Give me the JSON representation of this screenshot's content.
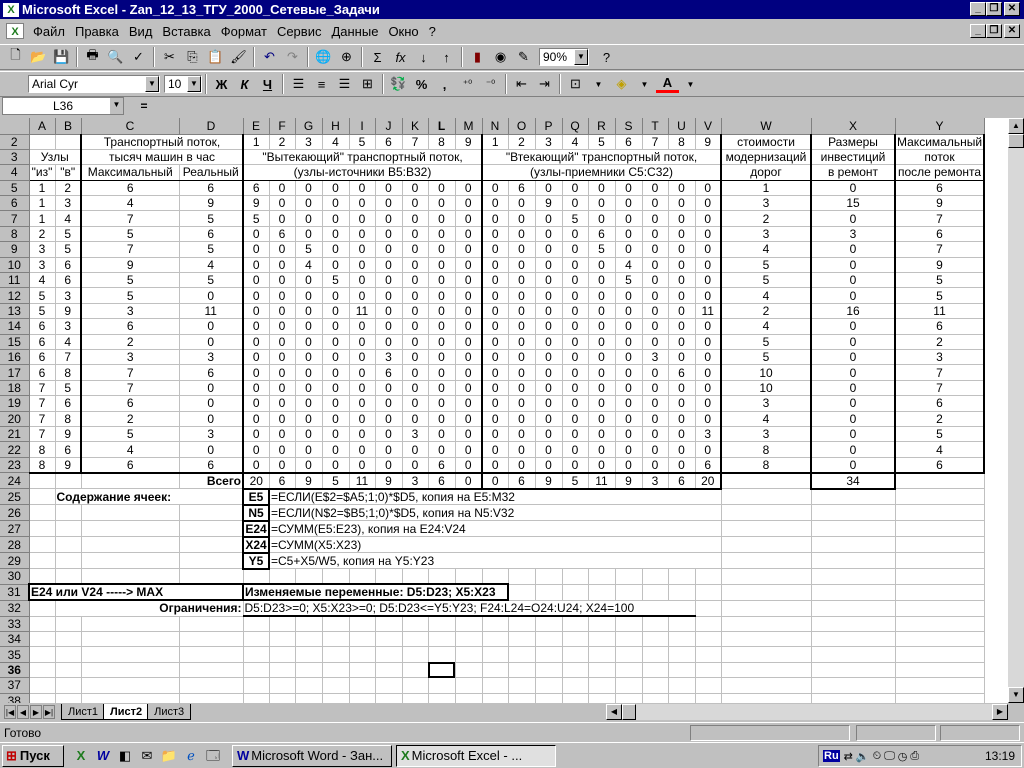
{
  "window": {
    "title": "Microsoft Excel - Zan_12_13_ТГУ_2000_Сетевые_Задачи",
    "icon": "excel-icon"
  },
  "menu": [
    "Файл",
    "Правка",
    "Вид",
    "Вставка",
    "Формат",
    "Сервис",
    "Данные",
    "Окно",
    "?"
  ],
  "toolbar": {
    "zoom": "90%",
    "font_name": "Arial Cyr",
    "font_size": "10",
    "bold_label": "Ж",
    "italic_label": "К",
    "underline_label": "Ч",
    "percent_label": "%",
    "thousands_label": ",",
    "sigma_label": "Σ",
    "fx_label": "fx",
    "help_label": "?"
  },
  "formula_bar": {
    "name_box": "L36",
    "equals": "=",
    "formula": ""
  },
  "sheet": {
    "columns": [
      "A",
      "B",
      "C",
      "D",
      "E",
      "F",
      "G",
      "H",
      "I",
      "J",
      "K",
      "L",
      "M",
      "N",
      "O",
      "P",
      "Q",
      "R",
      "S",
      "T",
      "U",
      "V",
      "W",
      "X",
      "Y"
    ],
    "active_column": "L",
    "active_row": "36",
    "row_headers": [
      "2",
      "3",
      "4",
      "5",
      "6",
      "7",
      "8",
      "9",
      "10",
      "11",
      "12",
      "13",
      "14",
      "15",
      "16",
      "17",
      "18",
      "19",
      "20",
      "21",
      "22",
      "23",
      "24",
      "25",
      "26",
      "27",
      "28",
      "29",
      "30",
      "31",
      "32",
      "33",
      "34",
      "35",
      "36",
      "37",
      "38",
      "39"
    ],
    "header_row2": {
      "C": "Транспортный поток,",
      "out_nums": [
        "1",
        "2",
        "3",
        "4",
        "5",
        "6",
        "7",
        "8",
        "9"
      ],
      "in_nums": [
        "1",
        "2",
        "3",
        "4",
        "5",
        "6",
        "7",
        "8",
        "9"
      ],
      "W": "стоимости",
      "X": "Размеры",
      "Y": "Максимальный"
    },
    "header_row3": {
      "AB": "Узлы",
      "C": "тысяч машин в час",
      "out": "\"Вытекающий\" транспортный поток,",
      "in": "\"Втекающий\" транспортный поток,",
      "W": "модернизаций",
      "X": "инвестиций",
      "Y": "поток"
    },
    "header_row4": {
      "A": "\"из\"",
      "B": "\"в\"",
      "C": "Максимальный",
      "D": "Реальный",
      "out": "(узлы-источники В5:В32)",
      "in": "(узлы-приемники С5:С32)",
      "W": "дорог",
      "X": "в ремонт",
      "Y": "после ремонта"
    },
    "data_rows": [
      [
        "1",
        "2",
        "6",
        "6",
        "6",
        "0",
        "0",
        "0",
        "0",
        "0",
        "0",
        "0",
        "0",
        "0",
        "6",
        "0",
        "0",
        "0",
        "0",
        "0",
        "0",
        "0",
        "1",
        "0",
        "6"
      ],
      [
        "1",
        "3",
        "4",
        "9",
        "9",
        "0",
        "0",
        "0",
        "0",
        "0",
        "0",
        "0",
        "0",
        "0",
        "0",
        "9",
        "0",
        "0",
        "0",
        "0",
        "0",
        "0",
        "3",
        "15",
        "9"
      ],
      [
        "1",
        "4",
        "7",
        "5",
        "5",
        "0",
        "0",
        "0",
        "0",
        "0",
        "0",
        "0",
        "0",
        "0",
        "0",
        "0",
        "5",
        "0",
        "0",
        "0",
        "0",
        "0",
        "2",
        "0",
        "7"
      ],
      [
        "2",
        "5",
        "5",
        "6",
        "0",
        "6",
        "0",
        "0",
        "0",
        "0",
        "0",
        "0",
        "0",
        "0",
        "0",
        "0",
        "0",
        "6",
        "0",
        "0",
        "0",
        "0",
        "3",
        "3",
        "6"
      ],
      [
        "3",
        "5",
        "7",
        "5",
        "0",
        "0",
        "5",
        "0",
        "0",
        "0",
        "0",
        "0",
        "0",
        "0",
        "0",
        "0",
        "0",
        "5",
        "0",
        "0",
        "0",
        "0",
        "4",
        "0",
        "7"
      ],
      [
        "3",
        "6",
        "9",
        "4",
        "0",
        "0",
        "4",
        "0",
        "0",
        "0",
        "0",
        "0",
        "0",
        "0",
        "0",
        "0",
        "0",
        "0",
        "4",
        "0",
        "0",
        "0",
        "5",
        "0",
        "9"
      ],
      [
        "4",
        "6",
        "5",
        "5",
        "0",
        "0",
        "0",
        "5",
        "0",
        "0",
        "0",
        "0",
        "0",
        "0",
        "0",
        "0",
        "0",
        "0",
        "5",
        "0",
        "0",
        "0",
        "5",
        "0",
        "5"
      ],
      [
        "5",
        "3",
        "5",
        "0",
        "0",
        "0",
        "0",
        "0",
        "0",
        "0",
        "0",
        "0",
        "0",
        "0",
        "0",
        "0",
        "0",
        "0",
        "0",
        "0",
        "0",
        "0",
        "4",
        "0",
        "5"
      ],
      [
        "5",
        "9",
        "3",
        "11",
        "0",
        "0",
        "0",
        "0",
        "11",
        "0",
        "0",
        "0",
        "0",
        "0",
        "0",
        "0",
        "0",
        "0",
        "0",
        "0",
        "0",
        "11",
        "2",
        "16",
        "11"
      ],
      [
        "6",
        "3",
        "6",
        "0",
        "0",
        "0",
        "0",
        "0",
        "0",
        "0",
        "0",
        "0",
        "0",
        "0",
        "0",
        "0",
        "0",
        "0",
        "0",
        "0",
        "0",
        "0",
        "4",
        "0",
        "6"
      ],
      [
        "6",
        "4",
        "2",
        "0",
        "0",
        "0",
        "0",
        "0",
        "0",
        "0",
        "0",
        "0",
        "0",
        "0",
        "0",
        "0",
        "0",
        "0",
        "0",
        "0",
        "0",
        "0",
        "5",
        "0",
        "2"
      ],
      [
        "6",
        "7",
        "3",
        "3",
        "0",
        "0",
        "0",
        "0",
        "0",
        "3",
        "0",
        "0",
        "0",
        "0",
        "0",
        "0",
        "0",
        "0",
        "0",
        "3",
        "0",
        "0",
        "5",
        "0",
        "3"
      ],
      [
        "6",
        "8",
        "7",
        "6",
        "0",
        "0",
        "0",
        "0",
        "0",
        "6",
        "0",
        "0",
        "0",
        "0",
        "0",
        "0",
        "0",
        "0",
        "0",
        "0",
        "6",
        "0",
        "10",
        "0",
        "7"
      ],
      [
        "7",
        "5",
        "7",
        "0",
        "0",
        "0",
        "0",
        "0",
        "0",
        "0",
        "0",
        "0",
        "0",
        "0",
        "0",
        "0",
        "0",
        "0",
        "0",
        "0",
        "0",
        "0",
        "10",
        "0",
        "7"
      ],
      [
        "7",
        "6",
        "6",
        "0",
        "0",
        "0",
        "0",
        "0",
        "0",
        "0",
        "0",
        "0",
        "0",
        "0",
        "0",
        "0",
        "0",
        "0",
        "0",
        "0",
        "0",
        "0",
        "3",
        "0",
        "6"
      ],
      [
        "7",
        "8",
        "2",
        "0",
        "0",
        "0",
        "0",
        "0",
        "0",
        "0",
        "0",
        "0",
        "0",
        "0",
        "0",
        "0",
        "0",
        "0",
        "0",
        "0",
        "0",
        "0",
        "4",
        "0",
        "2"
      ],
      [
        "7",
        "9",
        "5",
        "3",
        "0",
        "0",
        "0",
        "0",
        "0",
        "0",
        "3",
        "0",
        "0",
        "0",
        "0",
        "0",
        "0",
        "0",
        "0",
        "0",
        "0",
        "3",
        "3",
        "0",
        "5"
      ],
      [
        "8",
        "6",
        "4",
        "0",
        "0",
        "0",
        "0",
        "0",
        "0",
        "0",
        "0",
        "0",
        "0",
        "0",
        "0",
        "0",
        "0",
        "0",
        "0",
        "0",
        "0",
        "0",
        "8",
        "0",
        "4"
      ],
      [
        "8",
        "9",
        "6",
        "6",
        "0",
        "0",
        "0",
        "0",
        "0",
        "0",
        "0",
        "6",
        "0",
        "0",
        "0",
        "0",
        "0",
        "0",
        "0",
        "0",
        "0",
        "6",
        "8",
        "0",
        "6"
      ]
    ],
    "total_label": "Всего",
    "totals_out": [
      "20",
      "6",
      "9",
      "5",
      "11",
      "9",
      "3",
      "6",
      "0"
    ],
    "totals_in": [
      "0",
      "6",
      "9",
      "5",
      "11",
      "9",
      "3",
      "6",
      "20"
    ],
    "total_x": "34",
    "contents_label": "Содержание ячеек:",
    "formulas": [
      {
        "cell": "E5",
        "text": "=ЕСЛИ(E$2=$A5;1;0)*$D5,  копия на E5:M32"
      },
      {
        "cell": "N5",
        "text": "=ЕСЛИ(N$2=$B5;1;0)*$D5,  копия на N5:V32"
      },
      {
        "cell": "E24",
        "text": "=СУММ(E5:E23),  копия на E24:V24"
      },
      {
        "cell": "X24",
        "text": "=СУММ(X5:X23)"
      },
      {
        "cell": "Y5",
        "text": "=C5+X5/W5, копия на Y5:Y23"
      }
    ],
    "objective": "E24  или  V24   -----> MAX",
    "changing_label": "Изменяемые переменные:   D5:D23; X5:X23",
    "constraints_label": "Ограничения:",
    "constraints": "D5:D23>=0;  X5:X23>=0;  D5:D23<=Y5:Y23;  F24:L24=O24:U24;  X24=100"
  },
  "sheet_tabs": [
    "Лист1",
    "Лист2",
    "Лист3"
  ],
  "active_tab": "Лист2",
  "status": "Готово",
  "taskbar": {
    "start": "Пуск",
    "tasks": [
      "Microsoft Word - Зан...",
      "Microsoft Excel - ..."
    ],
    "clock": "13:19",
    "lang": "Ru"
  }
}
